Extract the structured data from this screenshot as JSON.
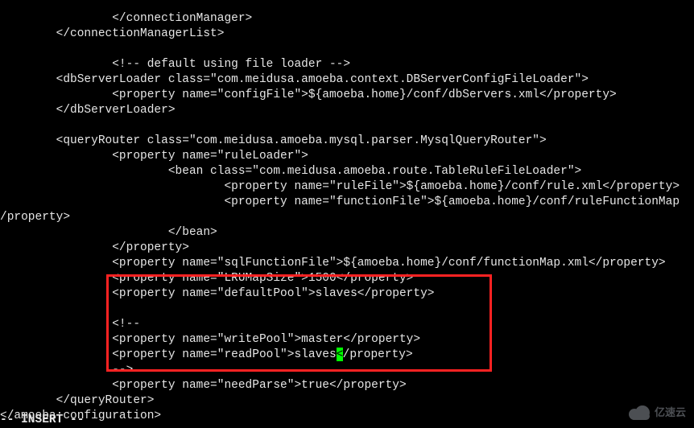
{
  "code": {
    "l01": "                </connectionManager>",
    "l02": "        </connectionManagerList>",
    "l03": "",
    "l04": "                <!-- default using file loader -->",
    "l05": "        <dbServerLoader class=\"com.meidusa.amoeba.context.DBServerConfigFileLoader\">",
    "l06": "                <property name=\"configFile\">${amoeba.home}/conf/dbServers.xml</property>",
    "l07": "        </dbServerLoader>",
    "l08": "",
    "l09": "        <queryRouter class=\"com.meidusa.amoeba.mysql.parser.MysqlQueryRouter\">",
    "l10": "                <property name=\"ruleLoader\">",
    "l11": "                        <bean class=\"com.meidusa.amoeba.route.TableRuleFileLoader\">",
    "l12": "                                <property name=\"ruleFile\">${amoeba.home}/conf/rule.xml</property>",
    "l13": "                                <property name=\"functionFile\">${amoeba.home}/conf/ruleFunctionMap",
    "l14": "/property>",
    "l15": "                        </bean>",
    "l16": "                </property>",
    "l17": "                <property name=\"sqlFunctionFile\">${amoeba.home}/conf/functionMap.xml</property>",
    "l18": "                <property name=\"LRUMapSize\">1500</property>",
    "l19": "                <property name=\"defaultPool\">slaves</property>",
    "l20": "",
    "l21": "                <!--",
    "l22": "                <property name=\"writePool\">master</property>",
    "l23a": "                <property name=\"readPool\">slaves",
    "l23b": "/property>",
    "l24": "                -->",
    "l25": "                <property name=\"needParse\">true</property>",
    "l26": "        </queryRouter>",
    "l27": "</amoeba:configuration>"
  },
  "cursor_char": "<",
  "mode": "-- INSERT --",
  "watermark": "亿速云"
}
